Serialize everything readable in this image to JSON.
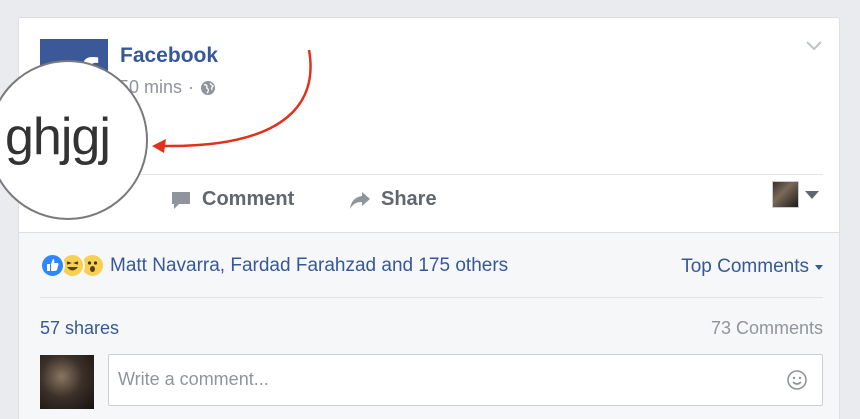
{
  "post": {
    "page_name": "Facebook",
    "timestamp": "50 mins",
    "separator": "·",
    "privacy_icon": "globe-icon",
    "post_text": "ghjgj"
  },
  "actions": {
    "comment_label": "Comment",
    "share_label": "Share"
  },
  "reactions": {
    "icons": [
      "like-reaction-icon",
      "haha-reaction-icon",
      "wow-reaction-icon"
    ],
    "names_text": "Matt Navarra, Fardad Farahzad and 175 others",
    "sort_label": "Top Comments"
  },
  "stats": {
    "shares": "57 shares",
    "comments": "73 Comments"
  },
  "composer": {
    "placeholder": "Write a comment..."
  },
  "colors": {
    "brand": "#3b5998",
    "link": "#365899",
    "annotation_arrow": "#e0311a"
  }
}
